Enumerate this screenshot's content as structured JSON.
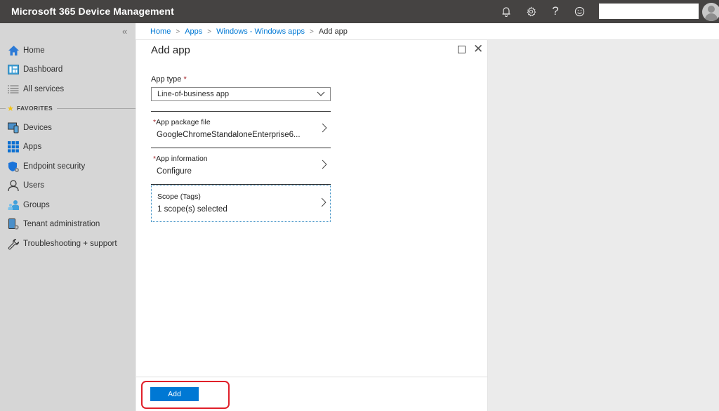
{
  "app": {
    "title": "Microsoft 365 Device Management"
  },
  "topbar": {
    "icons": [
      {
        "name": "notifications-bell-icon",
        "glyph": "🔔︎"
      },
      {
        "name": "settings-gear-icon",
        "glyph": "⚙"
      },
      {
        "name": "help-icon",
        "glyph": "?"
      },
      {
        "name": "feedback-smiley-icon",
        "glyph": "☺"
      }
    ],
    "account_search_value": ""
  },
  "sidebar": {
    "collapse_glyph": "«",
    "favorites_label": "FAVORITES",
    "items": [
      {
        "label": "Home",
        "icon": "home-icon"
      },
      {
        "label": "Dashboard",
        "icon": "dashboard-icon"
      },
      {
        "label": "All services",
        "icon": "list-icon"
      },
      {
        "label": "Devices",
        "icon": "devices-icon"
      },
      {
        "label": "Apps",
        "icon": "apps-grid-icon"
      },
      {
        "label": "Endpoint security",
        "icon": "shield-icon"
      },
      {
        "label": "Users",
        "icon": "user-icon"
      },
      {
        "label": "Groups",
        "icon": "groups-icon"
      },
      {
        "label": "Tenant administration",
        "icon": "tenant-admin-icon"
      },
      {
        "label": "Troubleshooting + support",
        "icon": "wrench-icon"
      }
    ]
  },
  "breadcrumb": {
    "items": [
      "Home",
      "Apps",
      "Windows - Windows apps"
    ],
    "current": "Add app",
    "separator": ">"
  },
  "panel": {
    "title": "Add app",
    "app_type_label": "App type",
    "required_mark": "*",
    "app_type_value": "Line-of-business app",
    "rows": [
      {
        "label": "App package file",
        "required": true,
        "value": "GoogleChromeStandaloneEnterprise6..."
      },
      {
        "label": "App information",
        "required": true,
        "value": "Configure"
      },
      {
        "label": "Scope (Tags)",
        "required": false,
        "value": "1 scope(s) selected"
      }
    ],
    "add_button_label": "Add"
  },
  "colors": {
    "accent": "#0078d4",
    "topbar": "#454342",
    "sidebar": "#d6d6d6",
    "required": "#a4262c",
    "highlight": "#e0202a"
  }
}
